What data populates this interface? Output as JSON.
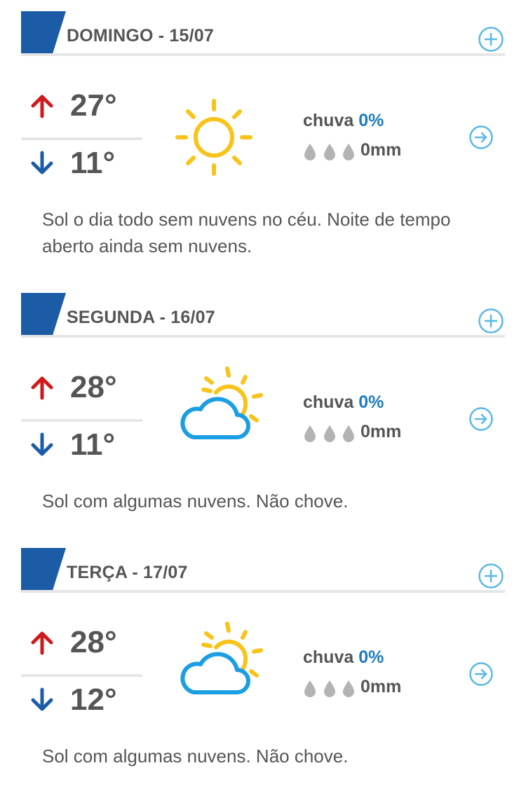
{
  "colors": {
    "accent_blue": "#1c5ca6",
    "max_arrow_red": "#d0191a",
    "min_arrow_blue": "#1c5ca6",
    "icon_light_blue": "#5ab7e6",
    "sun_yellow": "#f8c31b",
    "cloud_blue": "#1c9ee2",
    "rain_pct_blue": "#1e7cc4",
    "drop_gray": "#b3b3b3"
  },
  "days": [
    {
      "title": "DOMINGO - 15/07",
      "max_temp": "27°",
      "min_temp": "11°",
      "icon": "sun-icon",
      "rain_label": "chuva",
      "rain_pct": "0%",
      "rain_mm": "0mm",
      "summary": "Sol o dia todo sem nuvens no céu. Noite de tempo aberto ainda sem nuvens."
    },
    {
      "title": "SEGUNDA - 16/07",
      "max_temp": "28°",
      "min_temp": "11°",
      "icon": "partly-cloudy-icon",
      "rain_label": "chuva",
      "rain_pct": "0%",
      "rain_mm": "0mm",
      "summary": "Sol com algumas nuvens. Não chove."
    },
    {
      "title": "TERÇA - 17/07",
      "max_temp": "28°",
      "min_temp": "12°",
      "icon": "partly-cloudy-icon",
      "rain_label": "chuva",
      "rain_pct": "0%",
      "rain_mm": "0mm",
      "summary": "Sol com algumas nuvens. Não chove."
    }
  ]
}
